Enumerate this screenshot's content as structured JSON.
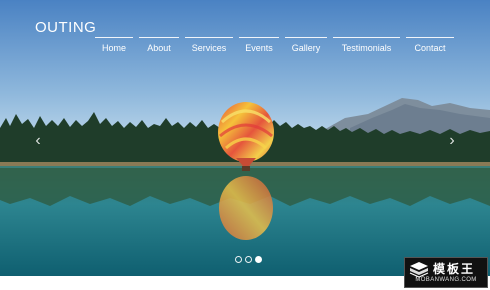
{
  "brand": {
    "title": "OUTING"
  },
  "nav": {
    "items": [
      {
        "label": "Home"
      },
      {
        "label": "About"
      },
      {
        "label": "Services"
      },
      {
        "label": "Events"
      },
      {
        "label": "Gallery"
      },
      {
        "label": "Testimonials"
      },
      {
        "label": "Contact"
      }
    ]
  },
  "slider": {
    "prev_icon": "chevron-left-icon",
    "next_icon": "chevron-right-icon",
    "prev_glyph": "‹",
    "next_glyph": "›",
    "slide_count": 3,
    "active_index": 2
  },
  "watermark": {
    "cn_text": "模板王",
    "url_text": "MOBANWANG.COM"
  },
  "colors": {
    "sky_top": "#4a82c3",
    "sky_bottom": "#cfe4f1",
    "forest": "#1f3d2a",
    "water": "#2b7f8d"
  }
}
